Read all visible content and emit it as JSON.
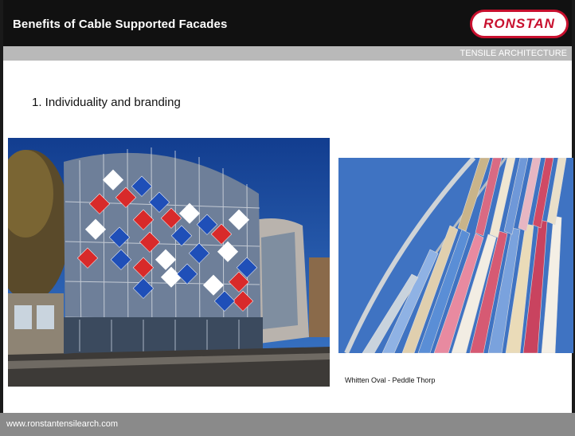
{
  "header": {
    "title": "Benefits of Cable Supported Facades",
    "logo_text": "RONSTAN"
  },
  "subbar": {
    "text": "TENSILE ARCHITECTURE"
  },
  "content": {
    "bullet": "1.  Individuality and branding",
    "caption": "Whitten Oval  -  Peddle Thorp"
  },
  "footer": {
    "url": "www.ronstantensilearch.com"
  },
  "colors": {
    "brand_red": "#c8102e",
    "header_bg": "#111111",
    "subbar_bg": "#b9b9b9",
    "footer_bg": "#8a8a8a"
  }
}
